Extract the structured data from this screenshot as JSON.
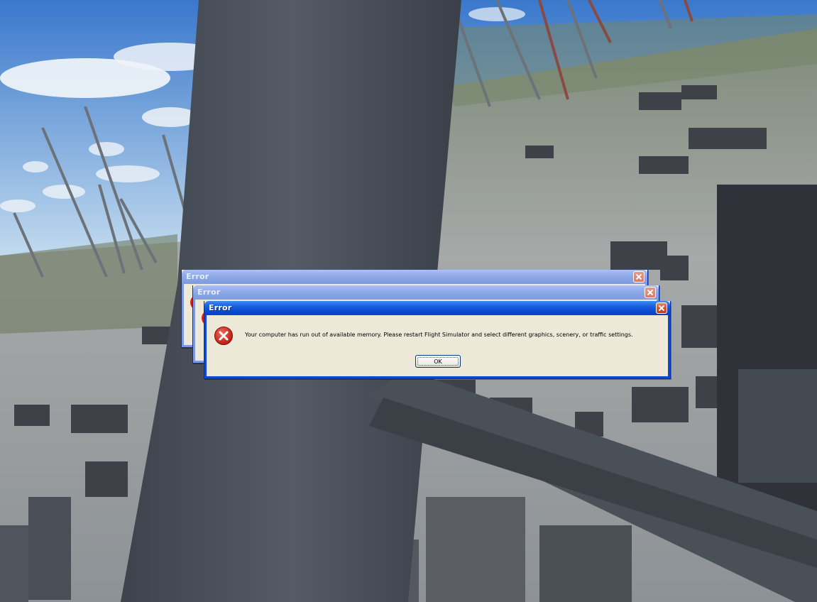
{
  "colors": {
    "sky_top": "#3f7fd0",
    "sky_bottom": "#cfe3f2",
    "strut": "#474d57",
    "ground": "#8f9499",
    "titlebar_active": "#0a4bd6",
    "titlebar_inactive": "#8ea9e8",
    "dialog_bg": "#ece9d8",
    "error_icon": "#d2231a"
  },
  "dialogs": [
    {
      "title": "Error",
      "state": "inactive"
    },
    {
      "title": "Error",
      "state": "inactive"
    },
    {
      "title": "Error",
      "state": "active",
      "icon": "error-icon",
      "message": "Your computer has run out of available memory. Please restart Flight Simulator and select different graphics, scenery, or traffic settings.",
      "ok_label": "OK"
    }
  ]
}
